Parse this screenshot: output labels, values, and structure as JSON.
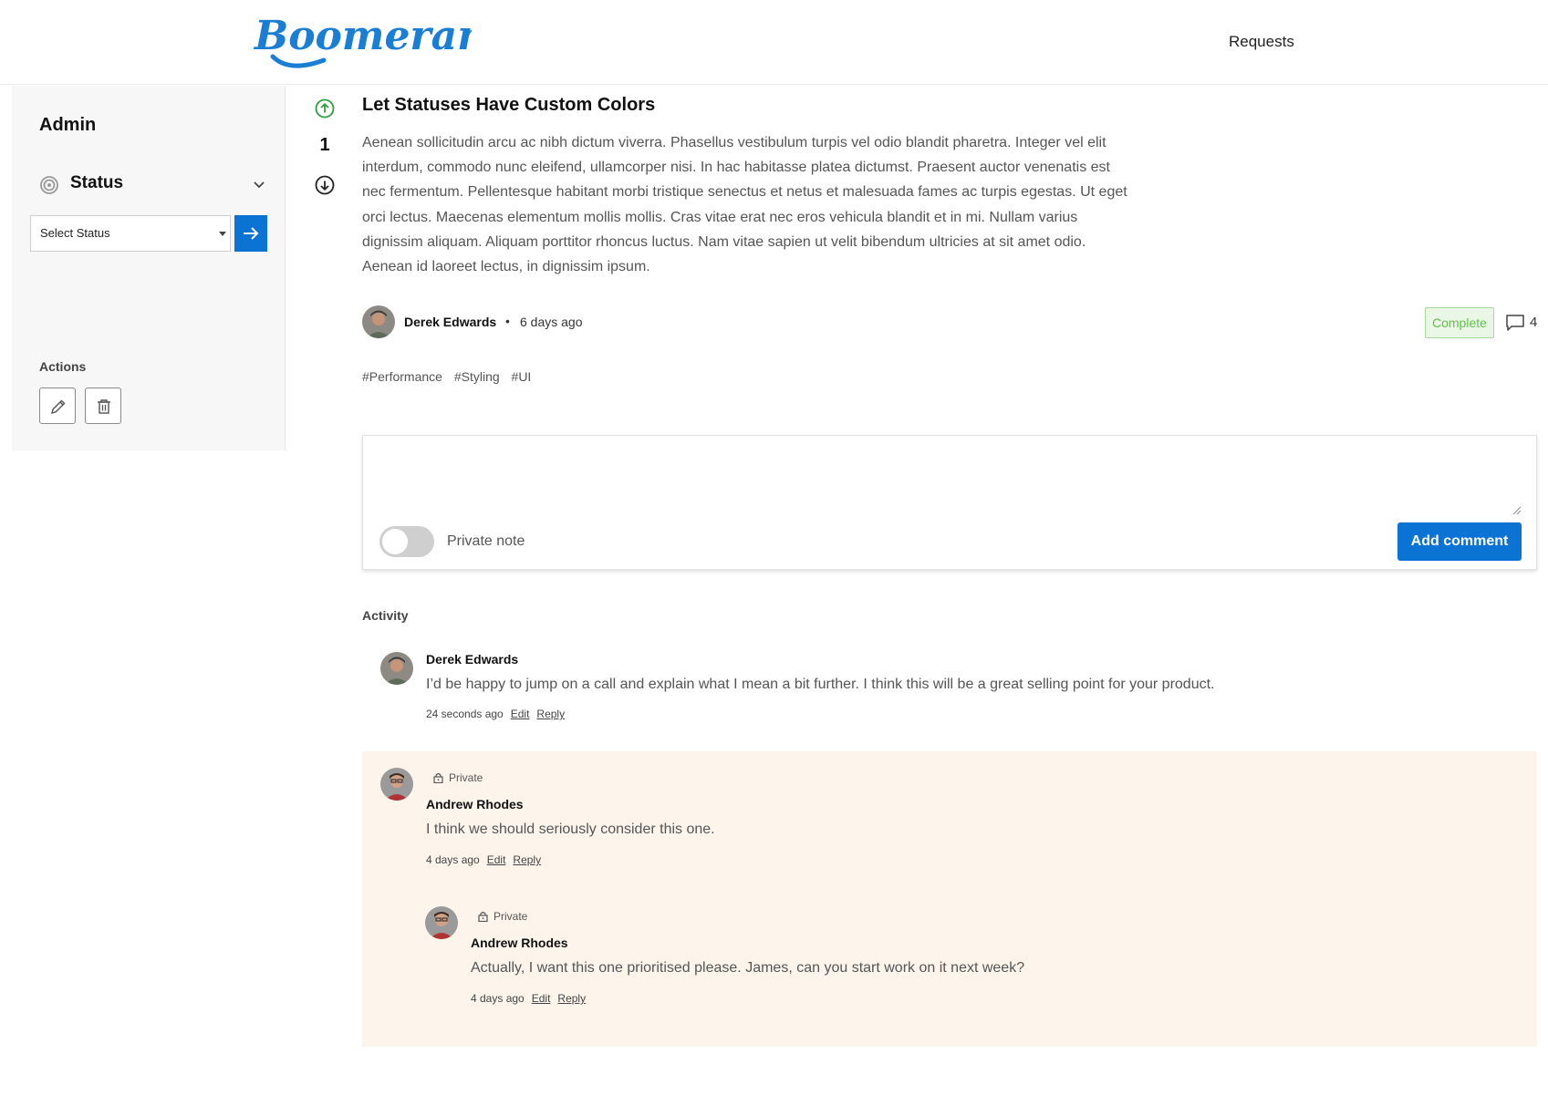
{
  "header": {
    "logo_text": "Boomerang",
    "nav": {
      "requests": "Requests"
    }
  },
  "sidebar": {
    "title": "Admin",
    "status_section": {
      "label": "Status",
      "icon": "target-icon"
    },
    "select": {
      "placeholder": "Select Status"
    },
    "actions_label": "Actions"
  },
  "post": {
    "votes": 1,
    "title": "Let Statuses Have Custom Colors",
    "body": "Aenean sollicitudin arcu ac nibh dictum viverra. Phasellus vestibulum turpis vel odio blandit pharetra. Integer vel elit interdum, commodo nunc eleifend, ullamcorper nisi. In hac habitasse platea dictumst. Praesent auctor venenatis est nec fermentum. Pellentesque habitant morbi tristique senectus et netus et malesuada fames ac turpis egestas. Ut eget orci lectus. Maecenas elementum mollis mollis. Cras vitae erat nec eros vehicula blandit et in mi. Nullam varius dignissim aliquam. Aliquam porttitor rhoncus luctus. Nam vitae sapien ut velit bibendum ultricies at sit amet odio. Aenean id laoreet lectus, in dignissim ipsum.",
    "author": "Derek Edwards",
    "separator": "•",
    "time": "6 days ago",
    "status": "Complete",
    "status_color": "#61c24b",
    "comment_count": "4",
    "tags": [
      "#Performance",
      "#Styling",
      "#UI"
    ]
  },
  "comment_form": {
    "private_label": "Private note",
    "submit_label": "Add comment"
  },
  "activity": {
    "label": "Activity",
    "comments": [
      {
        "author": "Derek Edwards",
        "text": "I’d be happy to jump on a call and explain what I mean a bit further. I think this will be a great selling point for your product.",
        "time": "24 seconds ago",
        "edit": "Edit",
        "reply": "Reply"
      },
      {
        "private": "Private",
        "author": "Andrew Rhodes",
        "text": "I think we should seriously consider this one.",
        "time": "4 days ago",
        "edit": "Edit",
        "reply": "Reply"
      },
      {
        "private": "Private",
        "author": "Andrew Rhodes",
        "text": "Actually, I want this one prioritised please. James, can you start work on it next week?",
        "time": "4 days ago",
        "edit": "Edit",
        "reply": "Reply"
      }
    ]
  },
  "colors": {
    "primary": "#0a73d4",
    "private_background": "#fdf5ec",
    "vote_up": "#2e9e3f"
  }
}
